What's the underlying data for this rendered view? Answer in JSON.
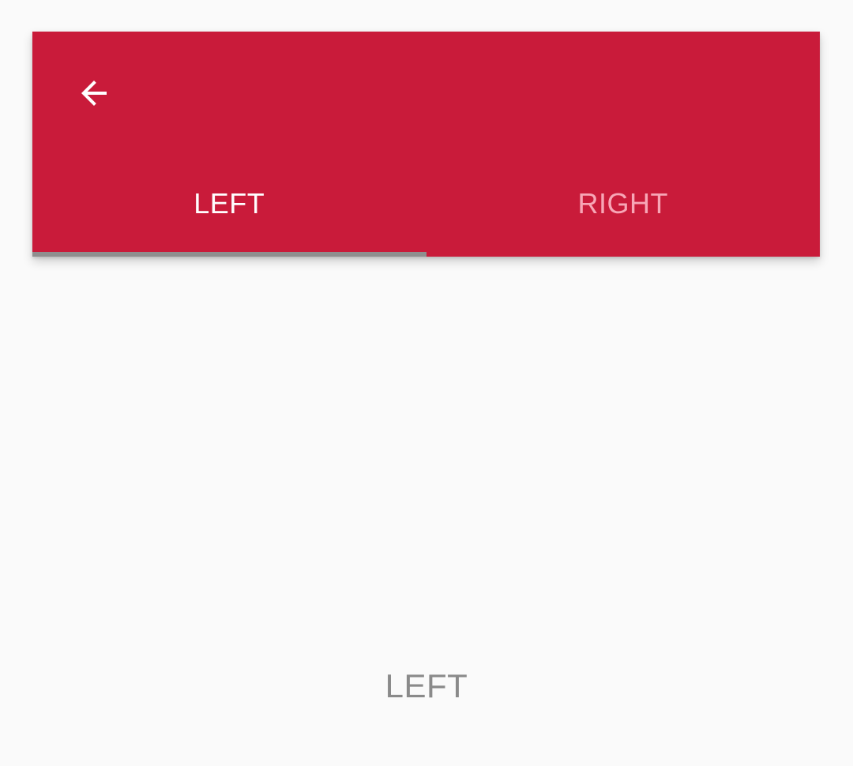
{
  "app_bar": {
    "background_color": "#c91b3a",
    "back_icon": "arrow-back-icon",
    "tabs": [
      {
        "label": "LEFT",
        "selected": true,
        "color": "#ffffff"
      },
      {
        "label": "RIGHT",
        "selected": false,
        "color": "#f7a6b6"
      }
    ],
    "indicator_color": "#8f8f8f"
  },
  "content": {
    "label": "LEFT",
    "text_color": "#8a8a8a"
  }
}
